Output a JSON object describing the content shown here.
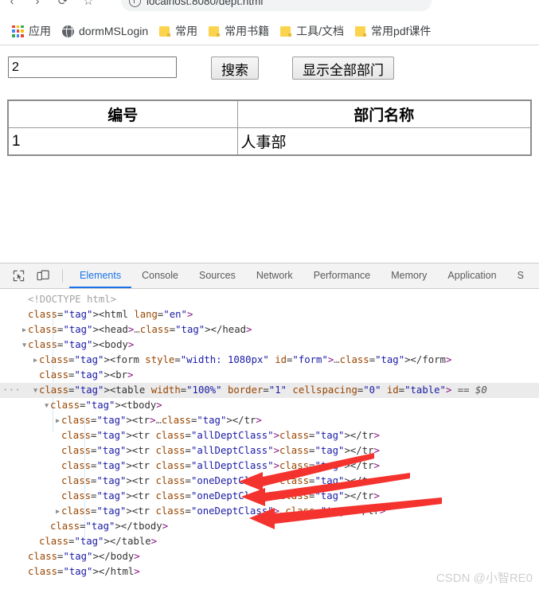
{
  "browser": {
    "nav_icons": [
      "back-arrow",
      "forward-arrow",
      "reload",
      "bookmark"
    ],
    "nav_glyphs": [
      "‹",
      "›",
      "⟳",
      "☆"
    ],
    "omnibox": {
      "url": "localhost:8080/dept.html",
      "secure_icon": "info-circle-icon"
    },
    "bookmarks": [
      {
        "label": "应用",
        "icon": "apps-grid-icon"
      },
      {
        "label": "dormMSLogin",
        "icon": "globe-icon"
      },
      {
        "label": "常用",
        "icon": "folder-icon"
      },
      {
        "label": "常用书籍",
        "icon": "folder-icon"
      },
      {
        "label": "工具/文档",
        "icon": "folder-icon"
      },
      {
        "label": "常用pdf课件",
        "icon": "folder-icon"
      }
    ],
    "apps_icon_colors": [
      "#ea4335",
      "#fbbc05",
      "#34a853",
      "#4285f4",
      "#ea4335",
      "#fbbc05",
      "#34a853",
      "#4285f4",
      "#ea4335"
    ]
  },
  "page": {
    "form": {
      "search_value": "2",
      "search_placeholder": "",
      "search_button": "搜索",
      "show_all_button": "显示全部部门"
    },
    "table": {
      "headers": [
        "编号",
        "部门名称"
      ],
      "rows": [
        {
          "id": "1",
          "name": "人事部"
        }
      ]
    }
  },
  "devtools": {
    "toolbar_icons": [
      "inspect-element-icon",
      "device-toolbar-icon"
    ],
    "tabs": [
      {
        "label": "Elements",
        "active": true
      },
      {
        "label": "Console",
        "active": false
      },
      {
        "label": "Sources",
        "active": false
      },
      {
        "label": "Network",
        "active": false
      },
      {
        "label": "Performance",
        "active": false
      },
      {
        "label": "Memory",
        "active": false
      },
      {
        "label": "Application",
        "active": false
      },
      {
        "label": "S",
        "active": false
      }
    ],
    "dom_lines": [
      {
        "indent": 0,
        "text": "<!DOCTYPE html>"
      },
      {
        "indent": 0,
        "text": "<html lang=\"en\">"
      },
      {
        "indent": 0,
        "text": "<head>…</head>"
      },
      {
        "indent": 0,
        "text": "<body>"
      },
      {
        "indent": 1,
        "text": "<form style=\"width: 1080px\" id=\"form\">…</form>"
      },
      {
        "indent": 1,
        "text": "<br>"
      },
      {
        "indent": 1,
        "text": "<table width=\"100%\" border=\"1\" cellspacing=\"0\" id=\"table\"> == $0"
      },
      {
        "indent": 2,
        "text": "<tbody>"
      },
      {
        "indent": 3,
        "text": "<tr>…</tr>"
      },
      {
        "indent": 3,
        "text": "<tr class=\"allDeptClass\"></tr>"
      },
      {
        "indent": 3,
        "text": "<tr class=\"allDeptClass\"></tr>"
      },
      {
        "indent": 3,
        "text": "<tr class=\"allDeptClass\"></tr>"
      },
      {
        "indent": 3,
        "text": "<tr class=\"oneDeptClass\"></tr>"
      },
      {
        "indent": 3,
        "text": "<tr class=\"oneDeptClass\"></tr>"
      },
      {
        "indent": 3,
        "text": "<tr class=\"oneDeptClass\">…</tr>"
      },
      {
        "indent": 2,
        "text": "</tbody>"
      },
      {
        "indent": 1,
        "text": "</table>"
      },
      {
        "indent": 0,
        "text": "</body>"
      },
      {
        "indent": 0,
        "text": "</html>"
      }
    ],
    "selected_node_marker": "== $0",
    "gutter_more": "···"
  },
  "annotation": {
    "arrow_color": "#f4322e",
    "arrow_count": 3,
    "targets": [
      "oneDeptClass row 1",
      "oneDeptClass row 2",
      "oneDeptClass row 3"
    ]
  },
  "watermark": "CSDN @小智RE0"
}
